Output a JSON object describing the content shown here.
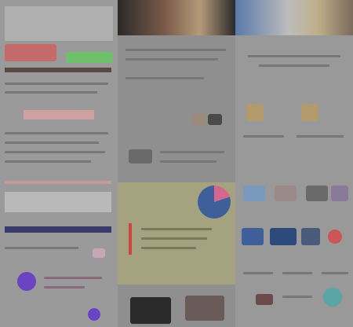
{
  "left": {
    "btn_red_label": "",
    "btn_green_label": "",
    "section_title": "",
    "footer_title": ""
  },
  "middle": {
    "hero_caption": "",
    "section_title": ""
  },
  "right": {
    "header_text": "",
    "grid_labels": [
      "",
      "",
      ""
    ]
  },
  "colors": {
    "red": "#c56a6a",
    "green": "#6ec16a",
    "navy": "#3a3a6a",
    "purple": "#6a44c2",
    "pink": "#d6678c",
    "blue_pie": "#3f5f9a",
    "yellow_panel": "#a5a37f"
  }
}
